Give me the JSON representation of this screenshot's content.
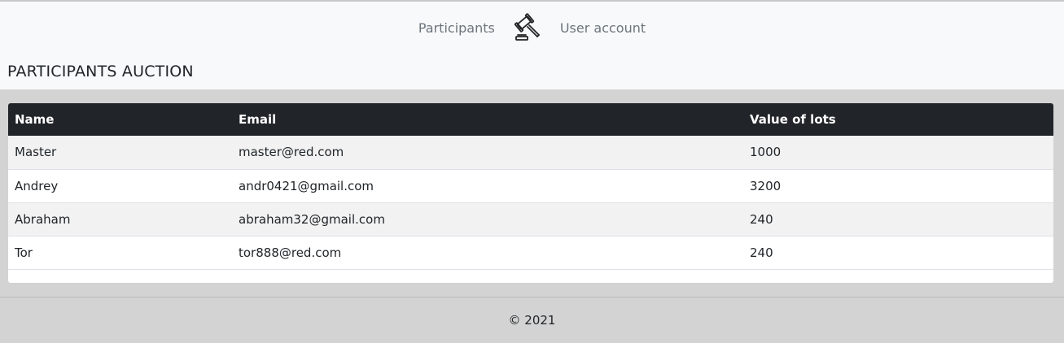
{
  "nav": {
    "participants_label": "Participants",
    "logo_icon": "gavel-icon",
    "user_account_label": "User account"
  },
  "page": {
    "title": "PARTICIPANTS AUCTION"
  },
  "table": {
    "headers": [
      "Name",
      "Email",
      "Value of lots"
    ],
    "rows": [
      {
        "name": "Master",
        "email": "master@red.com",
        "value": "1000"
      },
      {
        "name": "Andrey",
        "email": "andr0421@gmail.com",
        "value": "3200"
      },
      {
        "name": "Abraham",
        "email": "abraham32@gmail.com",
        "value": "240"
      },
      {
        "name": "Tor",
        "email": "tor888@red.com",
        "value": "240"
      }
    ]
  },
  "footer": {
    "text": "© 2021"
  },
  "colors": {
    "header_bg": "#f8f9fa",
    "table_head_bg": "#212529",
    "body_bg": "#d3d3d3",
    "nav_link": "#6c757d"
  }
}
